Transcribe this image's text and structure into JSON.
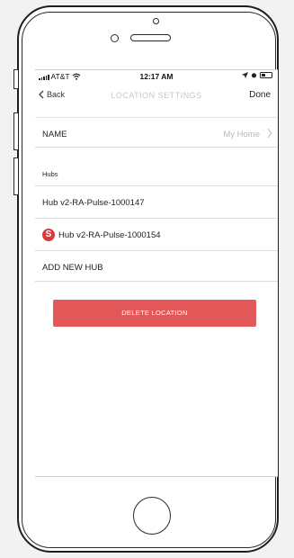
{
  "status_bar": {
    "carrier": "AT&T",
    "time": "12:17 AM"
  },
  "nav": {
    "back_label": "Back",
    "title": "LOCATION SETTINGS",
    "done_label": "Done"
  },
  "name_row": {
    "label": "NAME",
    "value": "My Home"
  },
  "hubs_section": {
    "header": "Hubs",
    "items": [
      {
        "label": "Hub v2-RA-Pulse-1000147"
      },
      {
        "label": "Hub v2-RA-Pulse-1000154",
        "badge": "S"
      }
    ],
    "add_label": "ADD NEW HUB"
  },
  "delete_button": {
    "label": "DELETE LOCATION",
    "color": "#e25757"
  }
}
